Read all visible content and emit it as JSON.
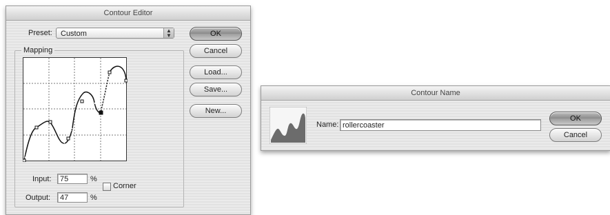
{
  "contour_editor": {
    "title": "Contour Editor",
    "preset_label": "Preset:",
    "preset_value": "Custom",
    "ok": "OK",
    "cancel": "Cancel",
    "load": "Load...",
    "save": "Save...",
    "new": "New...",
    "mapping_label": "Mapping",
    "input_label": "Input:",
    "input_value": "75",
    "input_unit": "%",
    "output_label": "Output:",
    "output_value": "47",
    "output_unit": "%",
    "corner_label": "Corner"
  },
  "contour_name": {
    "title": "Contour Name",
    "name_label": "Name:",
    "name_value": "rollercoaster",
    "ok": "OK",
    "cancel": "Cancel"
  }
}
